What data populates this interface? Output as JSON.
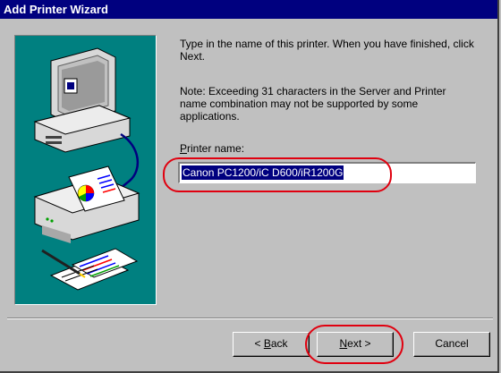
{
  "window": {
    "title": "Add Printer Wizard"
  },
  "content": {
    "instruction": "Type in the name of this printer.  When you have finished, click Next.",
    "note": "Note:  Exceeding 31 characters in the Server and Printer name combination may not be supported by some applications.",
    "printer_name_label_mnemonic": "P",
    "printer_name_label_rest": "rinter name:",
    "printer_name_value": "Canon PC1200/iC D600/iR1200G"
  },
  "buttons": {
    "back_prefix": "< ",
    "back_mnemonic": "B",
    "back_rest": "ack",
    "next_mnemonic": "N",
    "next_rest": "ext >",
    "cancel": "Cancel"
  },
  "illustration": {
    "icon": "printer-computer-illustration",
    "background_color": "#008080"
  },
  "colors": {
    "title_bar": "#00007f",
    "selection": "#00007f",
    "callout": "#e0000f"
  }
}
